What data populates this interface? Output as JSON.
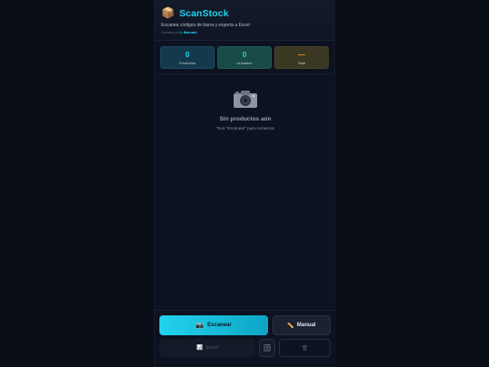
{
  "app": {
    "title": "ScanStock",
    "subtitle": "Escanea códigos de barra y exporta a Excel",
    "credit_prefix": "Creado por",
    "credit_author": "L.Mamani"
  },
  "stats": [
    {
      "value": "0",
      "label": "Productos"
    },
    {
      "value": "0",
      "label": "Unidades"
    },
    {
      "value": "—",
      "label": "Total"
    }
  ],
  "empty_state": {
    "icon": "camera-icon",
    "title": "Sin productos aún",
    "hint": "Toca \"Escanear\" para comenzar"
  },
  "actions": {
    "scan_label": "Escanear",
    "manual_label": "Manual",
    "excel_label": "Excel",
    "clear_glyph": "🗑"
  },
  "colors": {
    "accent": "#22d3ee",
    "units": "#34d399",
    "total": "#f59e0b",
    "background": "#0a0e17"
  }
}
